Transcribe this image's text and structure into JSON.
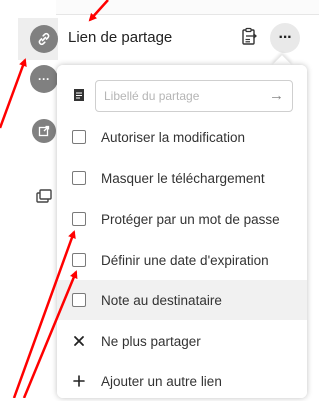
{
  "share": {
    "link_label": "Lien de partage",
    "more_button": "···"
  },
  "side": {
    "more_button": "···"
  },
  "menu": {
    "label_placeholder": "Libellé du partage",
    "submit_arrow": "→",
    "options": [
      {
        "label": "Autoriser la modification",
        "checked": false
      },
      {
        "label": "Masquer le téléchargement",
        "checked": false
      },
      {
        "label": "Protéger par un mot de passe",
        "checked": false
      },
      {
        "label": "Définir une date d'expiration",
        "checked": false
      },
      {
        "label": "Note au destinataire",
        "checked": false
      }
    ],
    "unshare_label": "Ne plus partager",
    "add_link_label": "Ajouter un autre lien"
  },
  "colors": {
    "annotation": "#ff0000",
    "avatar": "#808080",
    "highlight": "#f1f1f1"
  }
}
